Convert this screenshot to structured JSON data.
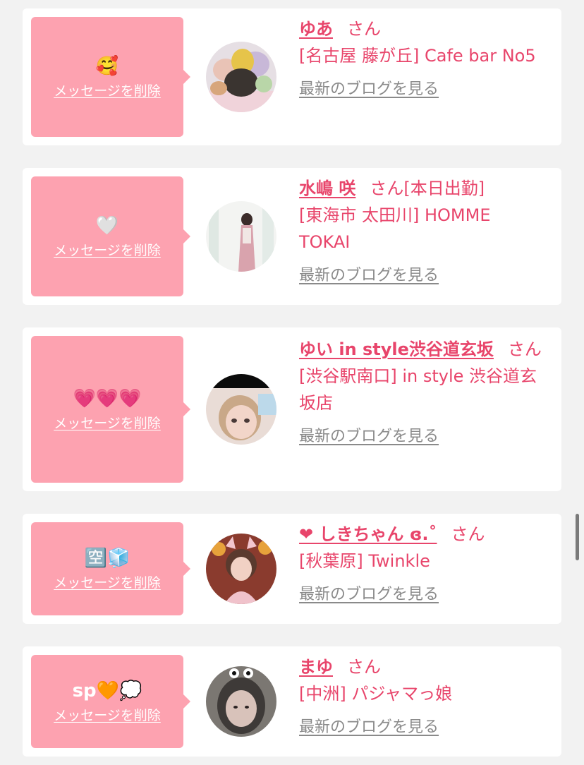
{
  "cards": [
    {
      "emoji": "🥰",
      "delete_label": "メッセージを削除",
      "name": "ゆあ",
      "honorific": "さん",
      "shop": "[名古屋 藤が丘] Cafe bar No5",
      "blog_label": "最新のブログを見る"
    },
    {
      "emoji": "🤍",
      "delete_label": "メッセージを削除",
      "name": "水嶋 咲",
      "honorific": "さん[本日出勤]",
      "shop": "[東海市 太田川] HOMME TOKAI",
      "blog_label": "最新のブログを見る"
    },
    {
      "emoji": "💗💗💗",
      "delete_label": "メッセージを削除",
      "name": "ゆい in style渋谷道玄坂",
      "honorific": "さん",
      "shop": "[渋谷駅南口] in style 渋谷道玄坂店",
      "blog_label": "最新のブログを見る"
    },
    {
      "emoji": "🈳🧊",
      "delete_label": "メッセージを削除",
      "name": "❤ しきちゃん ɞ.˚",
      "honorific": "さん",
      "shop": "[秋葉原] Twinkle",
      "blog_label": "最新のブログを見る"
    },
    {
      "emoji": "sp🧡💭",
      "delete_label": "メッセージを削除",
      "name": "まゆ",
      "honorific": "さん",
      "shop": "[中洲] パジャマっ娘",
      "blog_label": "最新のブログを見る"
    }
  ]
}
